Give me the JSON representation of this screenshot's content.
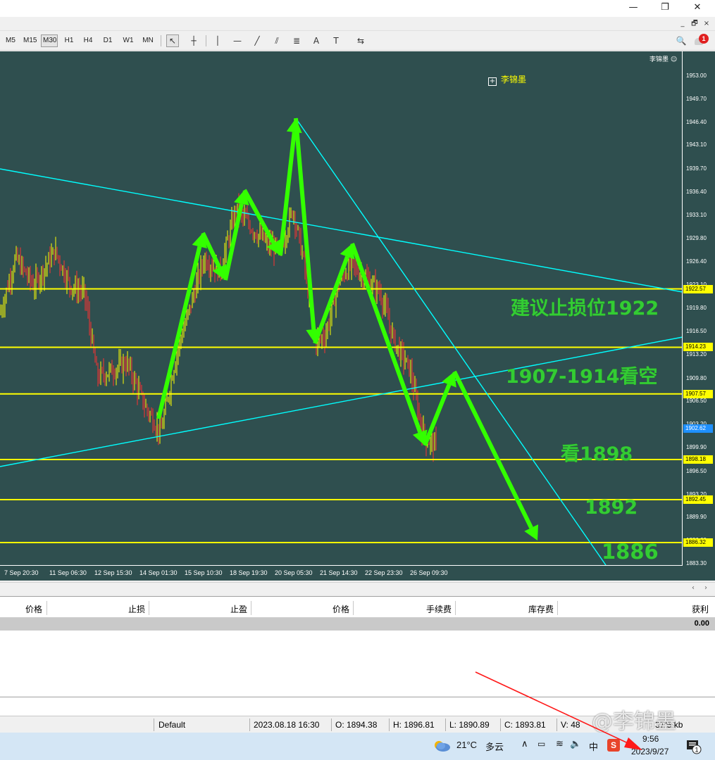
{
  "window": {
    "minimize": "—",
    "restore": "❐",
    "close": "✕"
  },
  "mdi": {
    "minimize": "_",
    "restore": "🗗",
    "close": "×"
  },
  "toolbar": {
    "timeframes": [
      "M5",
      "M15",
      "M30",
      "H1",
      "H4",
      "D1",
      "W1",
      "MN"
    ],
    "active_timeframe": "M30",
    "tools": [
      {
        "icon": "cursor-icon",
        "glyph": "↖"
      },
      {
        "icon": "crosshair-icon",
        "glyph": "┼"
      },
      {
        "icon": "vertical-line-icon",
        "glyph": "│"
      },
      {
        "icon": "horizontal-line-icon",
        "glyph": "—"
      },
      {
        "icon": "trendline-icon",
        "glyph": "╱"
      },
      {
        "icon": "equidistant-channel-icon",
        "glyph": "⫽"
      },
      {
        "icon": "fibonacci-icon",
        "glyph": "≣"
      },
      {
        "icon": "text-icon",
        "glyph": "A"
      },
      {
        "icon": "text-label-icon",
        "glyph": "T"
      },
      {
        "icon": "arrows-icon",
        "glyph": "⇆"
      }
    ],
    "search_icon": "🔍",
    "notification_count": "1"
  },
  "chart": {
    "watermark": "李锦墨",
    "corner_label": "李锦墨 ☺",
    "current_price": "1902.62",
    "price_ticks": [
      "1953.00",
      "1949.70",
      "1946.40",
      "1943.10",
      "1939.70",
      "1936.40",
      "1933.10",
      "1929.80",
      "1926.40",
      "1923.10",
      "1919.80",
      "1916.50",
      "1913.20",
      "1909.80",
      "1906.50",
      "1903.20",
      "1899.90",
      "1896.50",
      "1893.20",
      "1889.90",
      "1886.60",
      "1883.30"
    ],
    "levels": [
      "1922.57",
      "1914.23",
      "1907.57",
      "1898.18",
      "1892.45",
      "1886.32"
    ],
    "time_ticks": [
      "7 Sep 20:30",
      "11 Sep 06:30",
      "12 Sep 15:30",
      "14 Sep 01:30",
      "15 Sep 10:30",
      "18 Sep 19:30",
      "20 Sep 05:30",
      "21 Sep 14:30",
      "22 Sep 23:30",
      "26 Sep 09:30"
    ],
    "annotations": {
      "stop": "建议止损位1922",
      "short": "1907-1914看空",
      "t1": "看1898",
      "t2": "1892",
      "t3": "1886"
    },
    "colors": {
      "bg": "#2f4f4f",
      "level": "#ffff00",
      "trend": "#00ffff",
      "arrow": "#33ff00",
      "bull": "#ffff00",
      "bear": "#ff3030"
    }
  },
  "trade": {
    "headers": [
      "价格",
      "止损",
      "止盈",
      "价格",
      "手续费",
      "库存费",
      "获利"
    ],
    "balance": "0.00"
  },
  "status": {
    "profile": "Default",
    "datetime": "2023.08.18 16:30",
    "open": "O: 1894.38",
    "high": "H: 1896.81",
    "low": "L: 1890.89",
    "close": "C: 1893.81",
    "volume": "V: 48",
    "traffic": "37/5 kb"
  },
  "taskbar": {
    "weather_temp": "21°C",
    "weather_text": "多云",
    "ime": "中",
    "time": "9:56",
    "date": "2023/9/27",
    "notify_count": "1"
  },
  "overlay_watermark": "@李锦墨"
}
